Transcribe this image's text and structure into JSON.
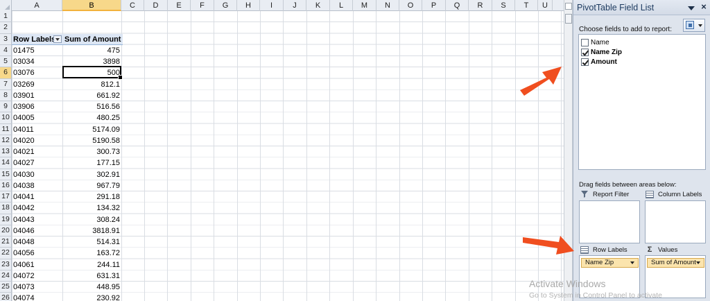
{
  "sheet": {
    "columns": [
      "A",
      "B",
      "C",
      "D",
      "E",
      "F",
      "G",
      "H",
      "I",
      "J",
      "K",
      "L",
      "M",
      "N",
      "O",
      "P",
      "Q",
      "R",
      "S",
      "T",
      "U"
    ],
    "selected_column": "B",
    "selected_row": "6",
    "row_numbers": [
      "1",
      "2",
      "3",
      "4",
      "5",
      "6",
      "7",
      "8",
      "9",
      "10",
      "11",
      "12",
      "13",
      "14",
      "15",
      "16",
      "17",
      "18",
      "19",
      "20",
      "21",
      "22",
      "23",
      "24",
      "25",
      "26"
    ],
    "header": {
      "row_labels": "Row Labels",
      "sum_of_amount": "Sum of Amount"
    },
    "rows": [
      {
        "label": "01475",
        "value": "475"
      },
      {
        "label": "03034",
        "value": "3898"
      },
      {
        "label": "03076",
        "value": "500"
      },
      {
        "label": "03269",
        "value": "812.1"
      },
      {
        "label": "03901",
        "value": "661.92"
      },
      {
        "label": "03906",
        "value": "516.56"
      },
      {
        "label": "04005",
        "value": "480.25"
      },
      {
        "label": "04011",
        "value": "5174.09"
      },
      {
        "label": "04020",
        "value": "5190.58"
      },
      {
        "label": "04021",
        "value": "300.73"
      },
      {
        "label": "04027",
        "value": "177.15"
      },
      {
        "label": "04030",
        "value": "302.91"
      },
      {
        "label": "04038",
        "value": "967.79"
      },
      {
        "label": "04041",
        "value": "291.18"
      },
      {
        "label": "04042",
        "value": "134.32"
      },
      {
        "label": "04043",
        "value": "308.24"
      },
      {
        "label": "04046",
        "value": "3818.91"
      },
      {
        "label": "04048",
        "value": "514.31"
      },
      {
        "label": "04056",
        "value": "163.72"
      },
      {
        "label": "04061",
        "value": "244.11"
      },
      {
        "label": "04072",
        "value": "631.31"
      },
      {
        "label": "04073",
        "value": "448.95"
      },
      {
        "label": "04074",
        "value": "230.92"
      }
    ]
  },
  "pivot_pane": {
    "title": "PivotTable Field List",
    "choose_label": "Choose fields to add to report:",
    "fields": [
      {
        "label": "Name",
        "checked": false
      },
      {
        "label": "Name Zip",
        "checked": true
      },
      {
        "label": "Amount",
        "checked": true
      }
    ],
    "drag_label": "Drag fields between areas below:",
    "areas": {
      "report_filter": {
        "label": "Report Filter",
        "icon": "filter-icon"
      },
      "column_labels": {
        "label": "Column Labels",
        "icon": "grid-icon"
      },
      "row_labels": {
        "label": "Row Labels",
        "icon": "grid-icon",
        "pill": "Name Zip"
      },
      "values": {
        "label": "Values",
        "icon": "sigma-icon",
        "symbol": "Σ",
        "pill": "Sum of Amount"
      }
    }
  },
  "watermark": {
    "title": "Activate Windows",
    "subtitle": "Go to System in Control Panel to activate"
  },
  "colors": {
    "arrow": "#f04e1f",
    "pivot_pill": "#fbe4ad",
    "selected_header": "#f7d88a",
    "pivot_header_row": "#dce6f4"
  }
}
